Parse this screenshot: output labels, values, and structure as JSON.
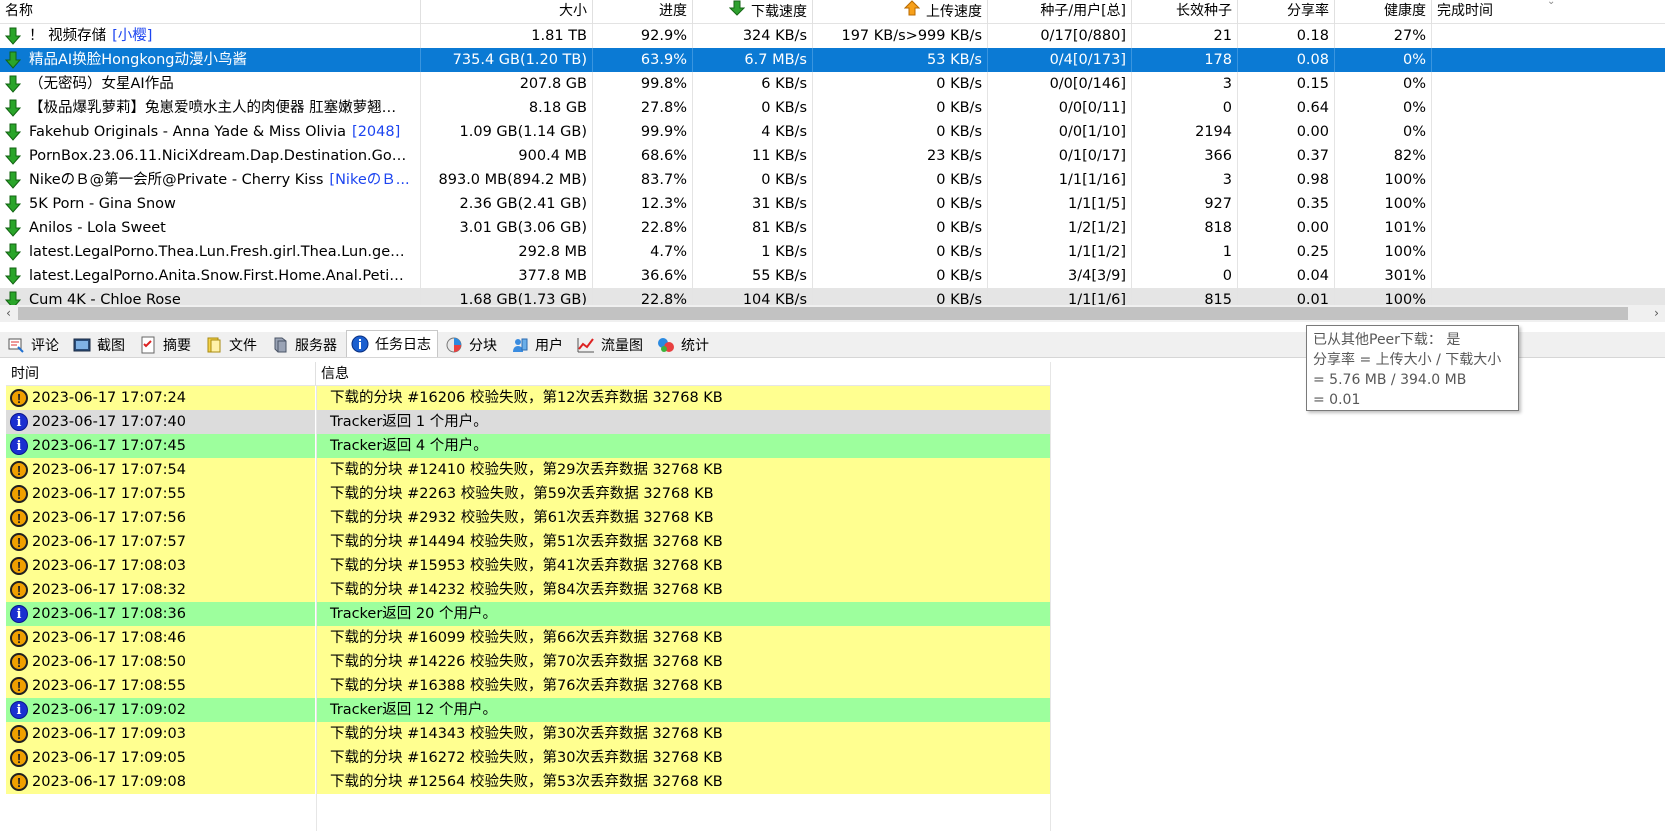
{
  "columns": [
    "名称",
    "大小",
    "进度",
    "下载速度",
    "上传速度",
    "种子/用户[总]",
    "长效种子",
    "分享率",
    "健康度",
    "完成时间"
  ],
  "colors": {
    "selection": "#0b7ad4",
    "warn_row": "#ffff90",
    "info_row": "#9dff9d",
    "tag_link": "#1d45f0"
  },
  "torrents": [
    {
      "name": "！ 视频存储",
      "tag": "[小樱]",
      "size": "1.81 TB",
      "progress": "92.9%",
      "down": "324 KB/s",
      "up": "197 KB/s>999 KB/s",
      "seeds": "0/17[0/880]",
      "long": "21",
      "ratio": "0.18",
      "health": "27%",
      "done": ""
    },
    {
      "name": "精品AI换脸Hongkong动漫小鸟酱",
      "tag": "",
      "size": "735.4 GB(1.20 TB)",
      "progress": "63.9%",
      "down": "6.7 MB/s",
      "up": "53 KB/s",
      "seeds": "0/4[0/173]",
      "long": "178",
      "ratio": "0.08",
      "health": "0%",
      "done": ""
    },
    {
      "name": "（无密码）女星AI作品",
      "tag": "",
      "size": "207.8 GB",
      "progress": "99.8%",
      "down": "6 KB/s",
      "up": "0 KB/s",
      "seeds": "0/0[0/146]",
      "long": "3",
      "ratio": "0.15",
      "health": "0%",
      "done": ""
    },
    {
      "name": "【极品爆乳萝莉】兔崽爱喷水主人的肉便器 肛塞嫩萝翘臀...",
      "tag": "",
      "size": "8.18 GB",
      "progress": "27.8%",
      "down": "0 KB/s",
      "up": "0 KB/s",
      "seeds": "0/0[0/11]",
      "long": "0",
      "ratio": "0.64",
      "health": "0%",
      "done": ""
    },
    {
      "name": "Fakehub Originals - Anna Yade & Miss Olivia",
      "tag": "[2048]",
      "size": "1.09 GB(1.14 GB)",
      "progress": "99.9%",
      "down": "4 KB/s",
      "up": "0 KB/s",
      "seeds": "0/0[1/10]",
      "long": "2194",
      "ratio": "0.00",
      "health": "0%",
      "done": ""
    },
    {
      "name": "PornBox.23.06.11.NiciXdream.Dap.Destination.Goes...",
      "tag": "",
      "size": "900.4 MB",
      "progress": "68.6%",
      "down": "11 KB/s",
      "up": "23 KB/s",
      "seeds": "0/1[0/17]",
      "long": "366",
      "ratio": "0.37",
      "health": "82%",
      "done": ""
    },
    {
      "name": "NikeのＢ@第一会所@Private - Cherry Kiss",
      "tag": "[NikeのＢ...",
      "size": "893.0 MB(894.2 MB)",
      "progress": "83.7%",
      "down": "0 KB/s",
      "up": "0 KB/s",
      "seeds": "1/1[1/16]",
      "long": "3",
      "ratio": "0.98",
      "health": "100%",
      "done": ""
    },
    {
      "name": "5K Porn - Gina Snow",
      "tag": "",
      "size": "2.36 GB(2.41 GB)",
      "progress": "12.3%",
      "down": "31 KB/s",
      "up": "0 KB/s",
      "seeds": "1/1[1/5]",
      "long": "927",
      "ratio": "0.35",
      "health": "100%",
      "done": ""
    },
    {
      "name": "Anilos - Lola Sweet",
      "tag": "",
      "size": "3.01 GB(3.06 GB)",
      "progress": "22.8%",
      "down": "81 KB/s",
      "up": "0 KB/s",
      "seeds": "1/2[1/2]",
      "long": "818",
      "ratio": "0.00",
      "health": "101%",
      "done": ""
    },
    {
      "name": "latest.LegalPorno.Thea.Lun.Fresh.girl.Thea.Lun.gets....",
      "tag": "",
      "size": "292.8 MB",
      "progress": "4.7%",
      "down": "1 KB/s",
      "up": "0 KB/s",
      "seeds": "1/1[1/2]",
      "long": "1",
      "ratio": "0.25",
      "health": "100%",
      "done": ""
    },
    {
      "name": "latest.LegalPorno.Anita.Snow.First.Home.Anal.Petite...",
      "tag": "",
      "size": "377.8 MB",
      "progress": "36.6%",
      "down": "55 KB/s",
      "up": "0 KB/s",
      "seeds": "3/4[3/9]",
      "long": "0",
      "ratio": "0.04",
      "health": "301%",
      "done": ""
    },
    {
      "name": "Cum 4K - Chloe Rose",
      "tag": "",
      "size": "1.68 GB(1.73 GB)",
      "progress": "22.8%",
      "down": "104 KB/s",
      "up": "0 KB/s",
      "seeds": "1/1[1/6]",
      "long": "815",
      "ratio": "0.01",
      "health": "100%",
      "done": ""
    }
  ],
  "tabs": [
    {
      "label": "评论",
      "icon": "comment-icon"
    },
    {
      "label": "截图",
      "icon": "screenshot-icon"
    },
    {
      "label": "摘要",
      "icon": "summary-icon"
    },
    {
      "label": "文件",
      "icon": "files-icon"
    },
    {
      "label": "服务器",
      "icon": "server-icon"
    },
    {
      "label": "任务日志",
      "icon": "info-icon",
      "active": true
    },
    {
      "label": "分块",
      "icon": "pieces-icon"
    },
    {
      "label": "用户",
      "icon": "users-icon"
    },
    {
      "label": "流量图",
      "icon": "chart-icon"
    },
    {
      "label": "统计",
      "icon": "stats-icon"
    }
  ],
  "log": {
    "headers": {
      "time": "时间",
      "message": "信息"
    },
    "rows": [
      {
        "type": "warn",
        "time": "2023-06-17 17:07:24",
        "msg": "下载的分块 #16206 校验失败，第12次丢弃数据 32768 KB"
      },
      {
        "type": "info-gray",
        "time": "2023-06-17 17:07:40",
        "msg": "Tracker返回 1 个用户。"
      },
      {
        "type": "info",
        "time": "2023-06-17 17:07:45",
        "msg": "Tracker返回 4 个用户。"
      },
      {
        "type": "warn",
        "time": "2023-06-17 17:07:54",
        "msg": "下载的分块 #12410 校验失败，第29次丢弃数据 32768 KB"
      },
      {
        "type": "warn",
        "time": "2023-06-17 17:07:55",
        "msg": "下载的分块 #2263 校验失败，第59次丢弃数据 32768 KB"
      },
      {
        "type": "warn",
        "time": "2023-06-17 17:07:56",
        "msg": "下载的分块 #2932 校验失败，第61次丢弃数据 32768 KB"
      },
      {
        "type": "warn",
        "time": "2023-06-17 17:07:57",
        "msg": "下载的分块 #14494 校验失败，第51次丢弃数据 32768 KB"
      },
      {
        "type": "warn",
        "time": "2023-06-17 17:08:03",
        "msg": "下载的分块 #15953 校验失败，第41次丢弃数据 32768 KB"
      },
      {
        "type": "warn",
        "time": "2023-06-17 17:08:32",
        "msg": "下载的分块 #14232 校验失败，第84次丢弃数据 32768 KB"
      },
      {
        "type": "info",
        "time": "2023-06-17 17:08:36",
        "msg": "Tracker返回 20 个用户。"
      },
      {
        "type": "warn",
        "time": "2023-06-17 17:08:46",
        "msg": "下载的分块 #16099 校验失败，第66次丢弃数据 32768 KB"
      },
      {
        "type": "warn",
        "time": "2023-06-17 17:08:50",
        "msg": "下载的分块 #14226 校验失败，第70次丢弃数据 32768 KB"
      },
      {
        "type": "warn",
        "time": "2023-06-17 17:08:55",
        "msg": "下载的分块 #16388 校验失败，第76次丢弃数据 32768 KB"
      },
      {
        "type": "info",
        "time": "2023-06-17 17:09:02",
        "msg": "Tracker返回 12 个用户。"
      },
      {
        "type": "warn",
        "time": "2023-06-17 17:09:03",
        "msg": "下载的分块 #14343 校验失败，第30次丢弃数据 32768 KB"
      },
      {
        "type": "warn",
        "time": "2023-06-17 17:09:05",
        "msg": "下载的分块 #16272 校验失败，第30次丢弃数据 32768 KB"
      },
      {
        "type": "warn",
        "time": "2023-06-17 17:09:08",
        "msg": "下载的分块 #12564 校验失败，第53次丢弃数据 32768 KB"
      }
    ]
  },
  "tooltip": {
    "lines": [
      "已从其他Peer下载：  是",
      "分享率 = 上传大小 / 下载大小",
      " = 5.76 MB / 394.0 MB",
      " = 0.01"
    ]
  }
}
